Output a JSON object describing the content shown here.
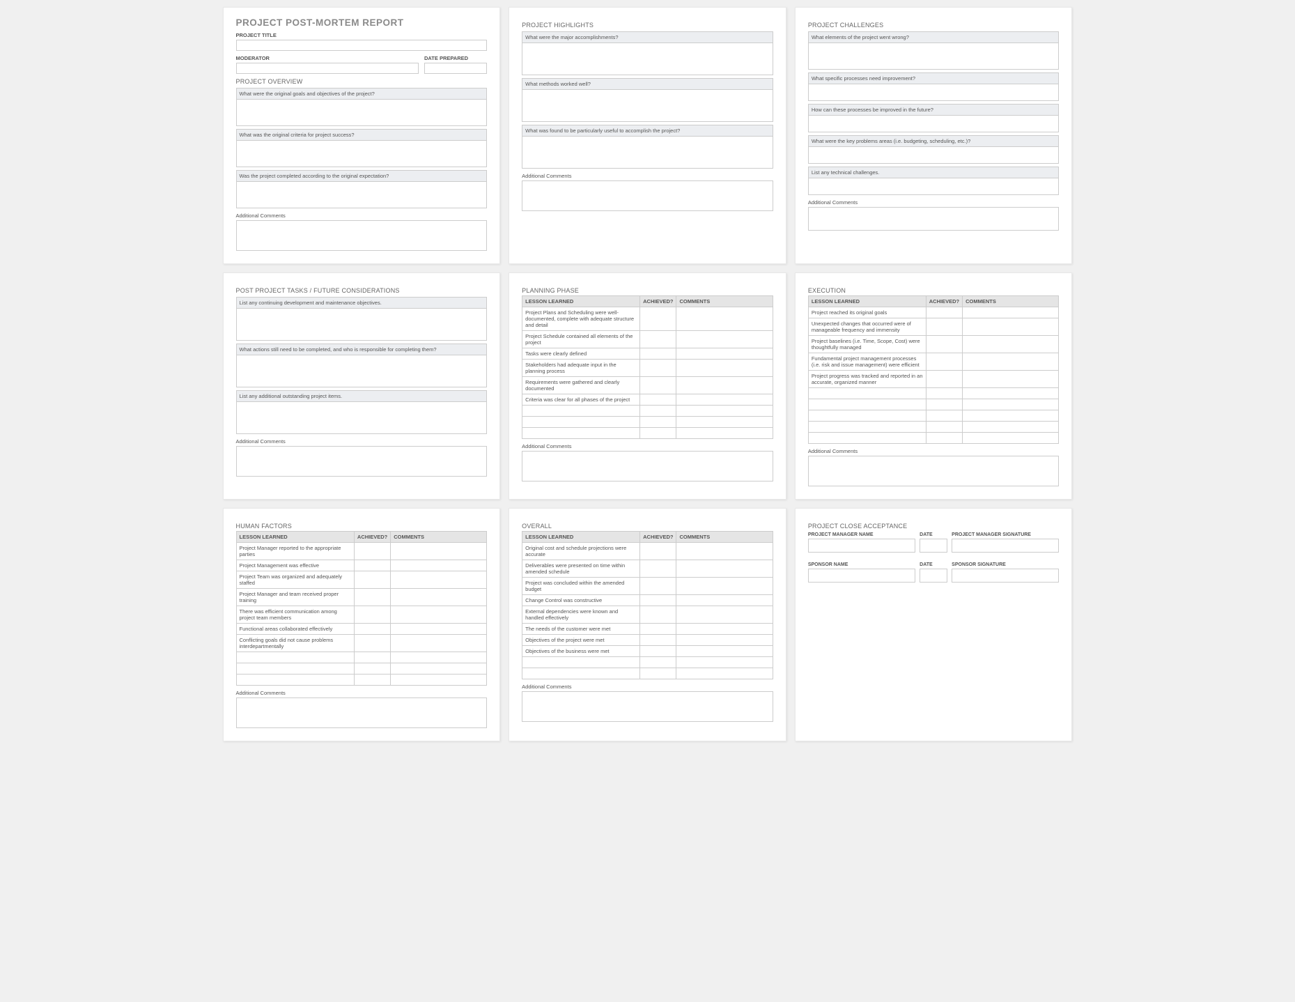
{
  "card1": {
    "main_title": "PROJECT POST-MORTEM REPORT",
    "project_title_label": "PROJECT TITLE",
    "moderator_label": "MODERATOR",
    "date_prepared_label": "DATE PREPARED",
    "overview_title": "PROJECT OVERVIEW",
    "q1": "What were the original goals and objectives of the project?",
    "q2": "What was the original criteria for project success?",
    "q3": "Was the project completed according to the original expectation?",
    "comments_label": "Additional Comments"
  },
  "card2": {
    "title": "PROJECT HIGHLIGHTS",
    "q1": "What were the major accomplishments?",
    "q2": "What methods worked well?",
    "q3": "What was found to be particularly useful to accomplish the project?",
    "comments_label": "Additional Comments"
  },
  "card3": {
    "title": "PROJECT CHALLENGES",
    "q1": "What elements of the project went wrong?",
    "q2": "What specific processes need improvement?",
    "q3": "How can these processes be improved in the future?",
    "q4": "What were the key problems areas (i.e. budgeting, scheduling, etc.)?",
    "q5": "List any technical challenges.",
    "comments_label": "Additional Comments"
  },
  "card4": {
    "title": "POST PROJECT TASKS / FUTURE CONSIDERATIONS",
    "q1": "List any continuing development and maintenance objectives.",
    "q2": "What actions still need to be completed, and who is responsible for completing them?",
    "q3": "List any additional outstanding project items.",
    "comments_label": "Additional Comments"
  },
  "table_headers": {
    "lesson": "LESSON LEARNED",
    "achieved": "ACHIEVED?",
    "comments": "COMMENTS"
  },
  "card5": {
    "title": "PLANNING PHASE",
    "lessons": [
      "Project Plans and Scheduling were well-documented, complete with adequate structure and detail",
      "Project Schedule contained all elements of the project",
      "Tasks were clearly defined",
      "Stakeholders had adequate input in the planning process",
      "Requirements were gathered and clearly documented",
      "Criteria was clear for all phases of the project",
      "",
      "",
      ""
    ],
    "comments_label": "Additional Comments"
  },
  "card6": {
    "title": "EXECUTION",
    "lessons": [
      "Project reached its original goals",
      "Unexpected changes that occurred were of manageable frequency and immensity",
      "Project baselines (i.e. Time, Scope, Cost) were thoughtfully managed",
      "Fundamental project management processes (i.e. risk and issue management) were efficient",
      "Project progress was tracked and reported in an accurate, organized manner",
      "",
      "",
      "",
      "",
      ""
    ],
    "comments_label": "Additional Comments"
  },
  "card7": {
    "title": "HUMAN FACTORS",
    "lessons": [
      "Project Manager reported to the appropriate parties",
      "Project Management was effective",
      "Project Team was organized and adequately staffed",
      "Project Manager and team received proper training",
      "There was efficient communication among project team members",
      "Functional areas collaborated effectively",
      "Conflicting goals did not cause problems interdepartmentally",
      "",
      "",
      ""
    ],
    "comments_label": "Additional Comments"
  },
  "card8": {
    "title": "OVERALL",
    "lessons": [
      "Original cost and schedule projections were accurate",
      "Deliverables were presented on time within amended schedule",
      "Project was concluded within the amended budget",
      "Change Control was constructive",
      "External dependencies were known and handled effectively",
      "The needs of the customer were met",
      "Objectives of the project were met",
      "Objectives of the business were met",
      "",
      ""
    ],
    "comments_label": "Additional Comments"
  },
  "card9": {
    "title": "PROJECT CLOSE ACCEPTANCE",
    "pm_name": "PROJECT MANAGER NAME",
    "date": "DATE",
    "pm_sig": "PROJECT MANAGER SIGNATURE",
    "sp_name": "SPONSOR NAME",
    "sp_sig": "SPONSOR SIGNATURE"
  }
}
